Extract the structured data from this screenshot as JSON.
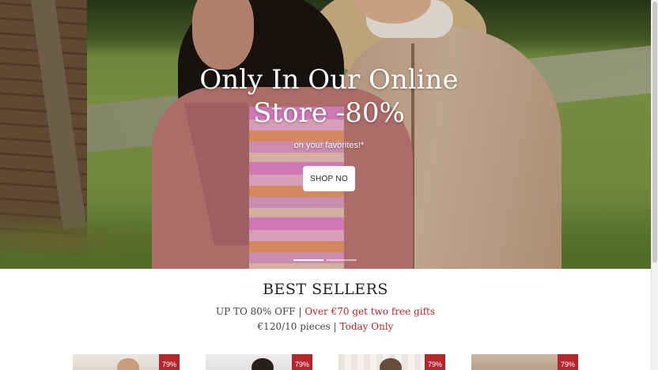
{
  "hero": {
    "title_line1": "Only In Our Online",
    "title_line2": "Store -80%",
    "subtitle": "on your favorites!*",
    "cta_label": "SHOP NO",
    "slides": [
      {
        "active": true
      },
      {
        "active": false
      }
    ]
  },
  "best_sellers": {
    "title": "BEST SELLERS",
    "line1_prefix": "UP TO 80% OFF",
    "line1_separator": "|",
    "line1_highlight": "Over €70 get two free gifts",
    "line2_prefix": "€120/10 pieces",
    "line2_separator": "|",
    "line2_highlight": "Today Only",
    "accent_color": "#b5262b"
  },
  "products": [
    {
      "badge": "79%"
    },
    {
      "badge": "79%"
    },
    {
      "badge": "79%"
    },
    {
      "badge": "79%"
    }
  ]
}
